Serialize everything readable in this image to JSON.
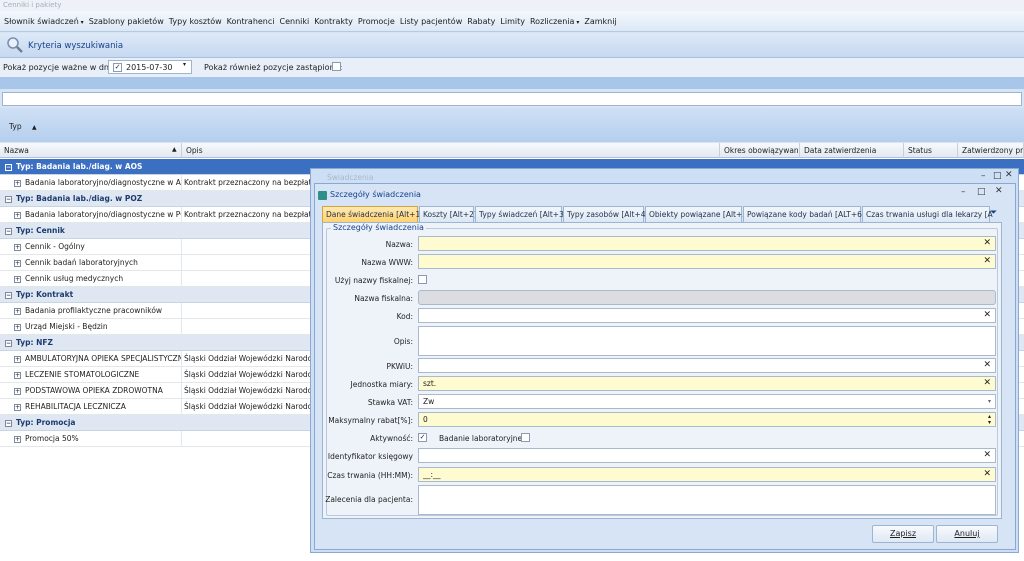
{
  "window": {
    "title": "Cenniki i pakiety"
  },
  "menu": [
    {
      "label": "Słownik świadczeń",
      "dropdown": true
    },
    {
      "label": "Szablony pakietów"
    },
    {
      "label": "Typy kosztów"
    },
    {
      "label": "Kontrahenci"
    },
    {
      "label": "Cenniki"
    },
    {
      "label": "Kontrakty"
    },
    {
      "label": "Promocje"
    },
    {
      "label": "Listy pacjentów"
    },
    {
      "label": "Rabaty"
    },
    {
      "label": "Limity"
    },
    {
      "label": "Rozliczenia",
      "dropdown": true
    },
    {
      "label": "Zamknij"
    }
  ],
  "criteria": {
    "label": "Kryteria wyszukiwania"
  },
  "filter": {
    "valid_label": "Pokaż pozycje ważne w dniu:",
    "date_value": "2015-07-30",
    "date_checked": true,
    "replaced_label": "Pokaż również pozycje zastąpione:",
    "replaced_checked": false
  },
  "groupby": {
    "label": "Typ",
    "sort": "▲"
  },
  "grid": {
    "columns": [
      "Nazwa",
      "Opis",
      "Okres obowiązywania",
      "Data zatwierdzenia",
      "Status",
      "Zatwierdzony prze"
    ],
    "groups": [
      {
        "title": "Typ: Badania lab./diag. w AOS",
        "selected": true,
        "rows": [
          {
            "name": "Badania laboratoryjno/diagnostyczne w AOS",
            "desc": "Kontrakt przeznaczony na bezpłatne"
          }
        ]
      },
      {
        "title": "Typ: Badania lab./diag. w POZ",
        "rows": [
          {
            "name": "Badania laboratoryjno/diagnostyczne w POZ",
            "desc": "Kontrakt przeznaczony na bezpłatne"
          }
        ]
      },
      {
        "title": "Typ: Cennik",
        "rows": [
          {
            "name": "Cennik - Ogólny",
            "desc": ""
          },
          {
            "name": "Cennik badań laboratoryjnych",
            "desc": ""
          },
          {
            "name": "Cennik usług medycznych",
            "desc": ""
          }
        ]
      },
      {
        "title": "Typ: Kontrakt",
        "rows": [
          {
            "name": "Badania profilaktyczne pracowników",
            "desc": ""
          },
          {
            "name": "Urząd Miejski - Będzin",
            "desc": ""
          }
        ]
      },
      {
        "title": "Typ: NFZ",
        "rows": [
          {
            "name": "AMBULATORYJNA OPIEKA SPECJALISTYCZNA",
            "desc": "Śląski Oddział Wojewódzki Narodowe"
          },
          {
            "name": "LECZENIE STOMATOLOGICZNE",
            "desc": "Śląski Oddział Wojewódzki Narodowe"
          },
          {
            "name": "PODSTAWOWA OPIEKA ZDROWOTNA",
            "desc": "Śląski Oddział Wojewódzki Narodowe"
          },
          {
            "name": "REHABILITACJA LECZNICZA",
            "desc": "Śląski Oddział Wojewódzki Narodowe"
          }
        ]
      },
      {
        "title": "Typ: Promocja",
        "rows": [
          {
            "name": "Promocja 50%",
            "desc": ""
          }
        ]
      }
    ]
  },
  "outer_dialog": {
    "title": "Świadczenia"
  },
  "dialog": {
    "title": "Szczegóły świadczenia",
    "tabs": [
      "Dane świadczenia [Alt+1]",
      "Koszty [Alt+2]",
      "Typy świadczeń [Alt+3]",
      "Typy zasobów [Alt+4]",
      "Obiekty powiązane [Alt+5]",
      "Powiązane kody badań [ALT+6]",
      "Czas trwania usługi dla lekarzy [A"
    ],
    "group_title": "Szczegóły świadczenia",
    "fields": {
      "nazwa": {
        "label": "Nazwa:",
        "value": ""
      },
      "nazwa_www": {
        "label": "Nazwa WWW:",
        "value": ""
      },
      "uzyj_fisk": {
        "label": "Użyj nazwy fiskalnej:",
        "checked": false
      },
      "nazwa_fisk": {
        "label": "Nazwa fiskalna:",
        "value": ""
      },
      "kod": {
        "label": "Kod:",
        "value": ""
      },
      "opis": {
        "label": "Opis:",
        "value": ""
      },
      "pkwiu": {
        "label": "PKWiU:",
        "value": ""
      },
      "jm": {
        "label": "Jednostka miary:",
        "value": "szt."
      },
      "vat": {
        "label": "Stawka VAT:",
        "value": "Zw"
      },
      "rabat": {
        "label": "Maksymalny rabat[%]:",
        "value": "0"
      },
      "aktywnosc": {
        "label": "Aktywność:",
        "checked": true
      },
      "badanie_lab": {
        "label": "Badanie laboratoryjne:",
        "checked": false
      },
      "ident": {
        "label": "Identyfikator księgowy",
        "value": ""
      },
      "czas": {
        "label": "Czas trwania (HH:MM):",
        "value": "__:__"
      },
      "zalecenia": {
        "label": "Zalecenia dla pacjenta:",
        "value": ""
      }
    },
    "save_label": "Zapisz",
    "cancel_label": "Anuluj"
  },
  "colors": {
    "accent": "#3a6fc2",
    "required_field": "#fefbd0",
    "active_tab": "#ffd36e"
  }
}
